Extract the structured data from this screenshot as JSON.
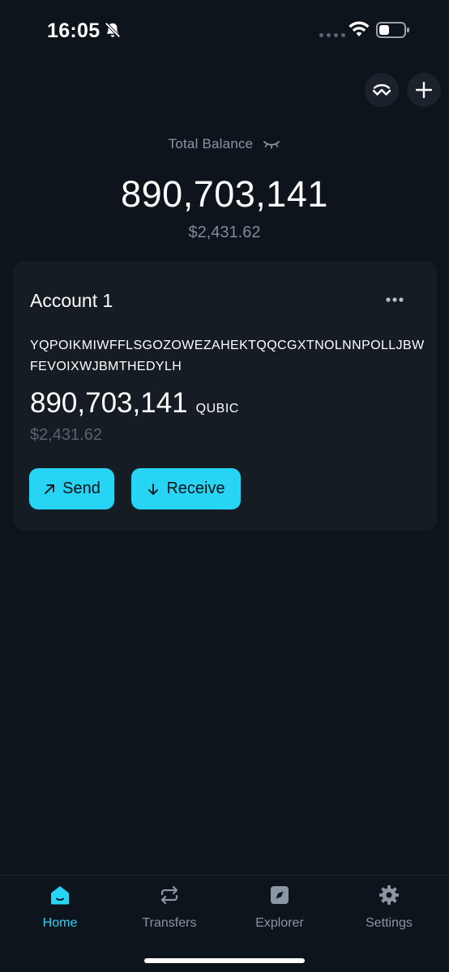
{
  "status_bar": {
    "time": "16:05"
  },
  "header": {
    "walletconnect_icon": "walletconnect-icon",
    "add_icon": "plus-icon"
  },
  "total": {
    "label": "Total Balance",
    "amount": "890,703,141",
    "fiat": "$2,431.62"
  },
  "account": {
    "name": "Account 1",
    "address": "YQPOIKMIWFFLSGOZOWEZAHEKTQQCGXTNOLNNPOLLJBWFEVOIXWJBMTHEDYLH",
    "amount": "890,703,141",
    "unit": "QUBIC",
    "fiat": "$2,431.62",
    "send_label": "Send",
    "receive_label": "Receive"
  },
  "nav": {
    "items": [
      {
        "label": "Home",
        "icon": "home-icon",
        "active": true
      },
      {
        "label": "Transfers",
        "icon": "transfer-icon",
        "active": false
      },
      {
        "label": "Explorer",
        "icon": "compass-icon",
        "active": false
      },
      {
        "label": "Settings",
        "icon": "gear-icon",
        "active": false
      }
    ]
  },
  "colors": {
    "accent": "#27d4f3",
    "background": "#0d141c",
    "card": "#151c24"
  }
}
